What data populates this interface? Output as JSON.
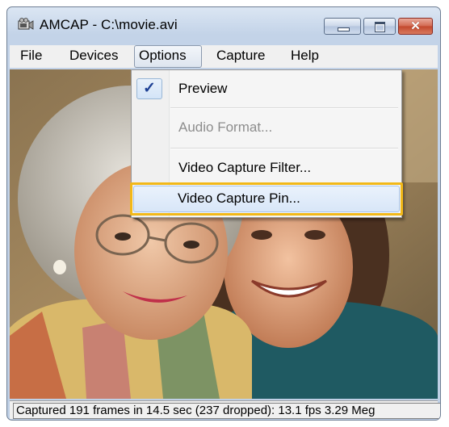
{
  "window": {
    "title": "AMCAP - C:\\movie.avi",
    "app_icon": "camera-icon",
    "caption_buttons": {
      "minimize": "minimize-icon",
      "maximize": "maximize-icon",
      "close": "✕"
    }
  },
  "menubar": {
    "items": [
      {
        "label": "File"
      },
      {
        "label": "Devices"
      },
      {
        "label": "Options",
        "open": true
      },
      {
        "label": "Capture"
      },
      {
        "label": "Help"
      }
    ]
  },
  "options_menu": {
    "items": [
      {
        "label": "Preview",
        "checked": true,
        "check_glyph": "✓"
      },
      {
        "label": "Audio Format...",
        "enabled": false
      },
      {
        "label": "Video Capture Filter..."
      },
      {
        "label": "Video Capture Pin...",
        "highlighted": true
      }
    ]
  },
  "content": {
    "image": "preview-video-frame"
  },
  "statusbar": {
    "text": "Captured 191 frames in 14.5 sec (237 dropped): 13.1 fps 3.29 Meg"
  },
  "colors": {
    "highlight_border": "#f2b818",
    "check_mark": "#1c3f94",
    "close_button": "#c2472c",
    "disabled_text": "#8d8d8d"
  }
}
